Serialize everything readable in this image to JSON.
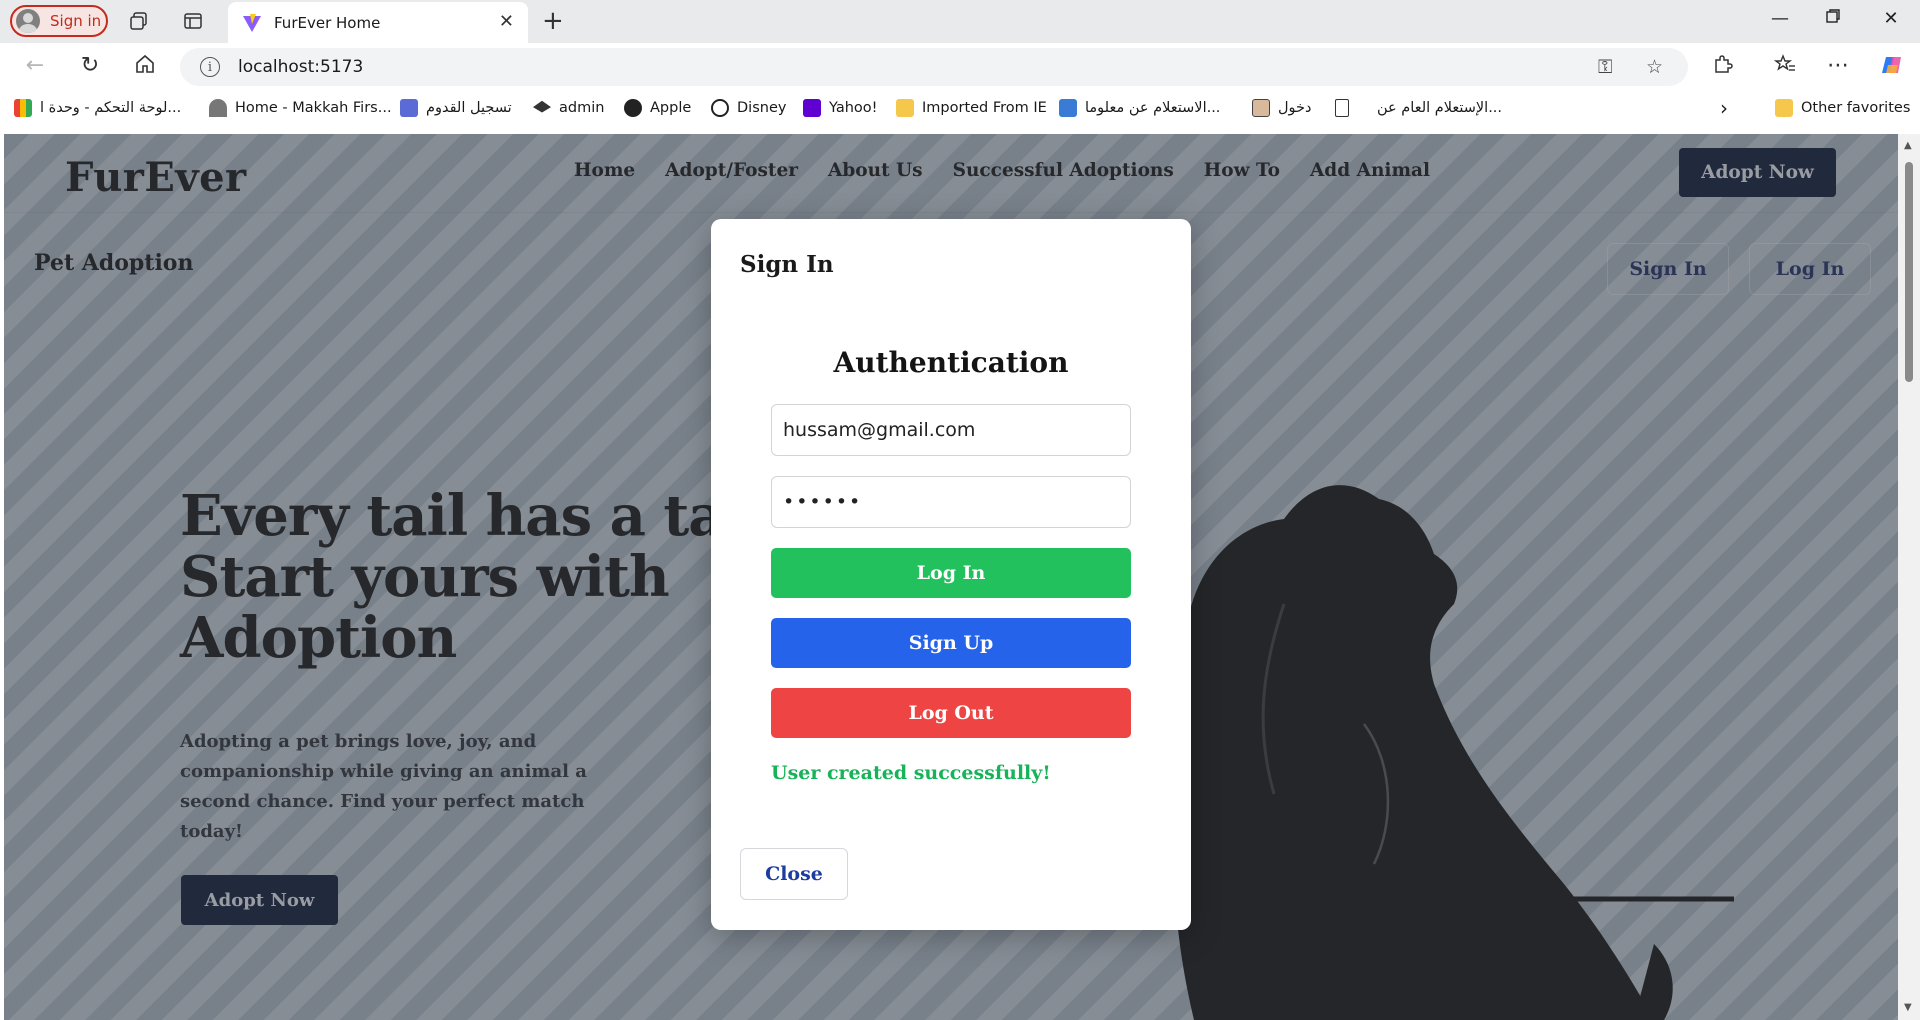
{
  "browser": {
    "profile_label": "Sign in",
    "tab_title": "FurEver Home",
    "url": "localhost:5173",
    "bookmarks": [
      {
        "label": "لوحة التحكم - وحدة ا...",
        "icon": "gmail-icon"
      },
      {
        "label": "Home - Makkah Firs...",
        "icon": "bird-icon"
      },
      {
        "label": "تسجيل القدوم",
        "icon": "site-icon"
      },
      {
        "label": "admin",
        "icon": "graduation-cap-icon"
      },
      {
        "label": "Apple",
        "icon": "apple-icon"
      },
      {
        "label": "Disney",
        "icon": "disney-icon"
      },
      {
        "label": "Yahoo!",
        "icon": "yahoo-icon"
      },
      {
        "label": "Imported From IE",
        "icon": "folder-icon"
      },
      {
        "label": "الاستعلام عن معلوما...",
        "icon": "site-icon"
      },
      {
        "label": "دخول",
        "icon": "image-icon"
      },
      {
        "label": "الإستعلام العام عن...",
        "icon": "file-icon"
      }
    ],
    "other_favorites": "Other favorites"
  },
  "site": {
    "logo": "FurEver",
    "nav": [
      "Home",
      "Adopt/Foster",
      "About Us",
      "Successful Adoptions",
      "How To",
      "Add Animal"
    ],
    "adopt_now": "Adopt Now",
    "subbar_title": "Pet Adoption",
    "sign_in": "Sign In",
    "log_in": "Log In",
    "hero_line1": "Every tail has a tale",
    "hero_line2": "Start yours with",
    "hero_line3": "Adoption",
    "hero_text": "Adopting a pet brings love, joy, and companionship while giving an animal a second chance. Find your perfect match today!",
    "hero_button": "Adopt Now"
  },
  "modal": {
    "title": "Sign In",
    "heading": "Authentication",
    "email_value": "hussam@gmail.com",
    "password_value": "••••••",
    "login_button": "Log In",
    "signup_button": "Sign Up",
    "logout_button": "Log Out",
    "status_message": "User created successfully!",
    "close_button": "Close"
  },
  "colors": {
    "navy": "#0c1635",
    "green": "#22c15e",
    "blue": "#2563eb",
    "red": "#ef4444",
    "success_text": "#16b358"
  }
}
